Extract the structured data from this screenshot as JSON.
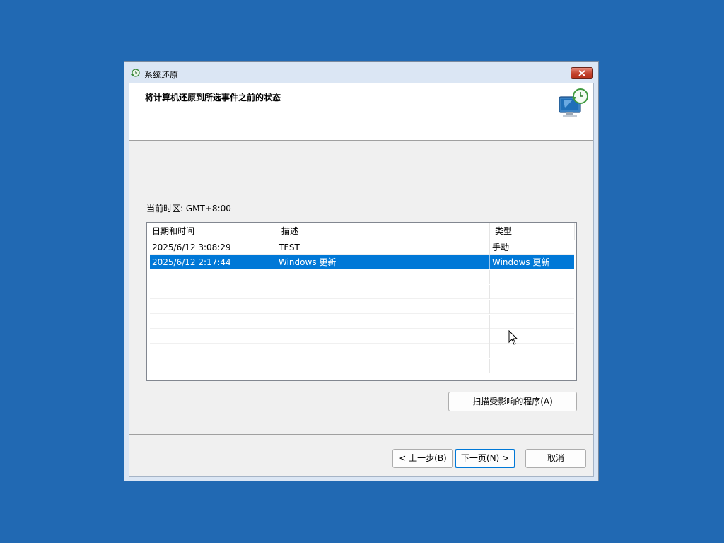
{
  "window": {
    "title": "系统还原",
    "heading": "将计算机还原到所选事件之前的状态"
  },
  "timezone_label": "当前时区: GMT+8:00",
  "restore_points": {
    "columns": [
      "日期和时间",
      "描述",
      "类型"
    ],
    "rows": [
      {
        "date": "2025/6/12 3:08:29",
        "description": "TEST",
        "type": "手动",
        "selected": false
      },
      {
        "date": "2025/6/12 2:17:44",
        "description": "Windows 更新",
        "type": "Windows 更新",
        "selected": true
      }
    ]
  },
  "buttons": {
    "scan": "扫描受影响的程序(A)",
    "back": "< 上一步(B)",
    "next": "下一页(N) >",
    "cancel": "取消"
  },
  "colors": {
    "desktop": "#2169b3",
    "selection": "#0078d7"
  },
  "icons": {
    "title": "system-restore-icon",
    "header": "computer-restore-icon",
    "close": "close-icon"
  }
}
